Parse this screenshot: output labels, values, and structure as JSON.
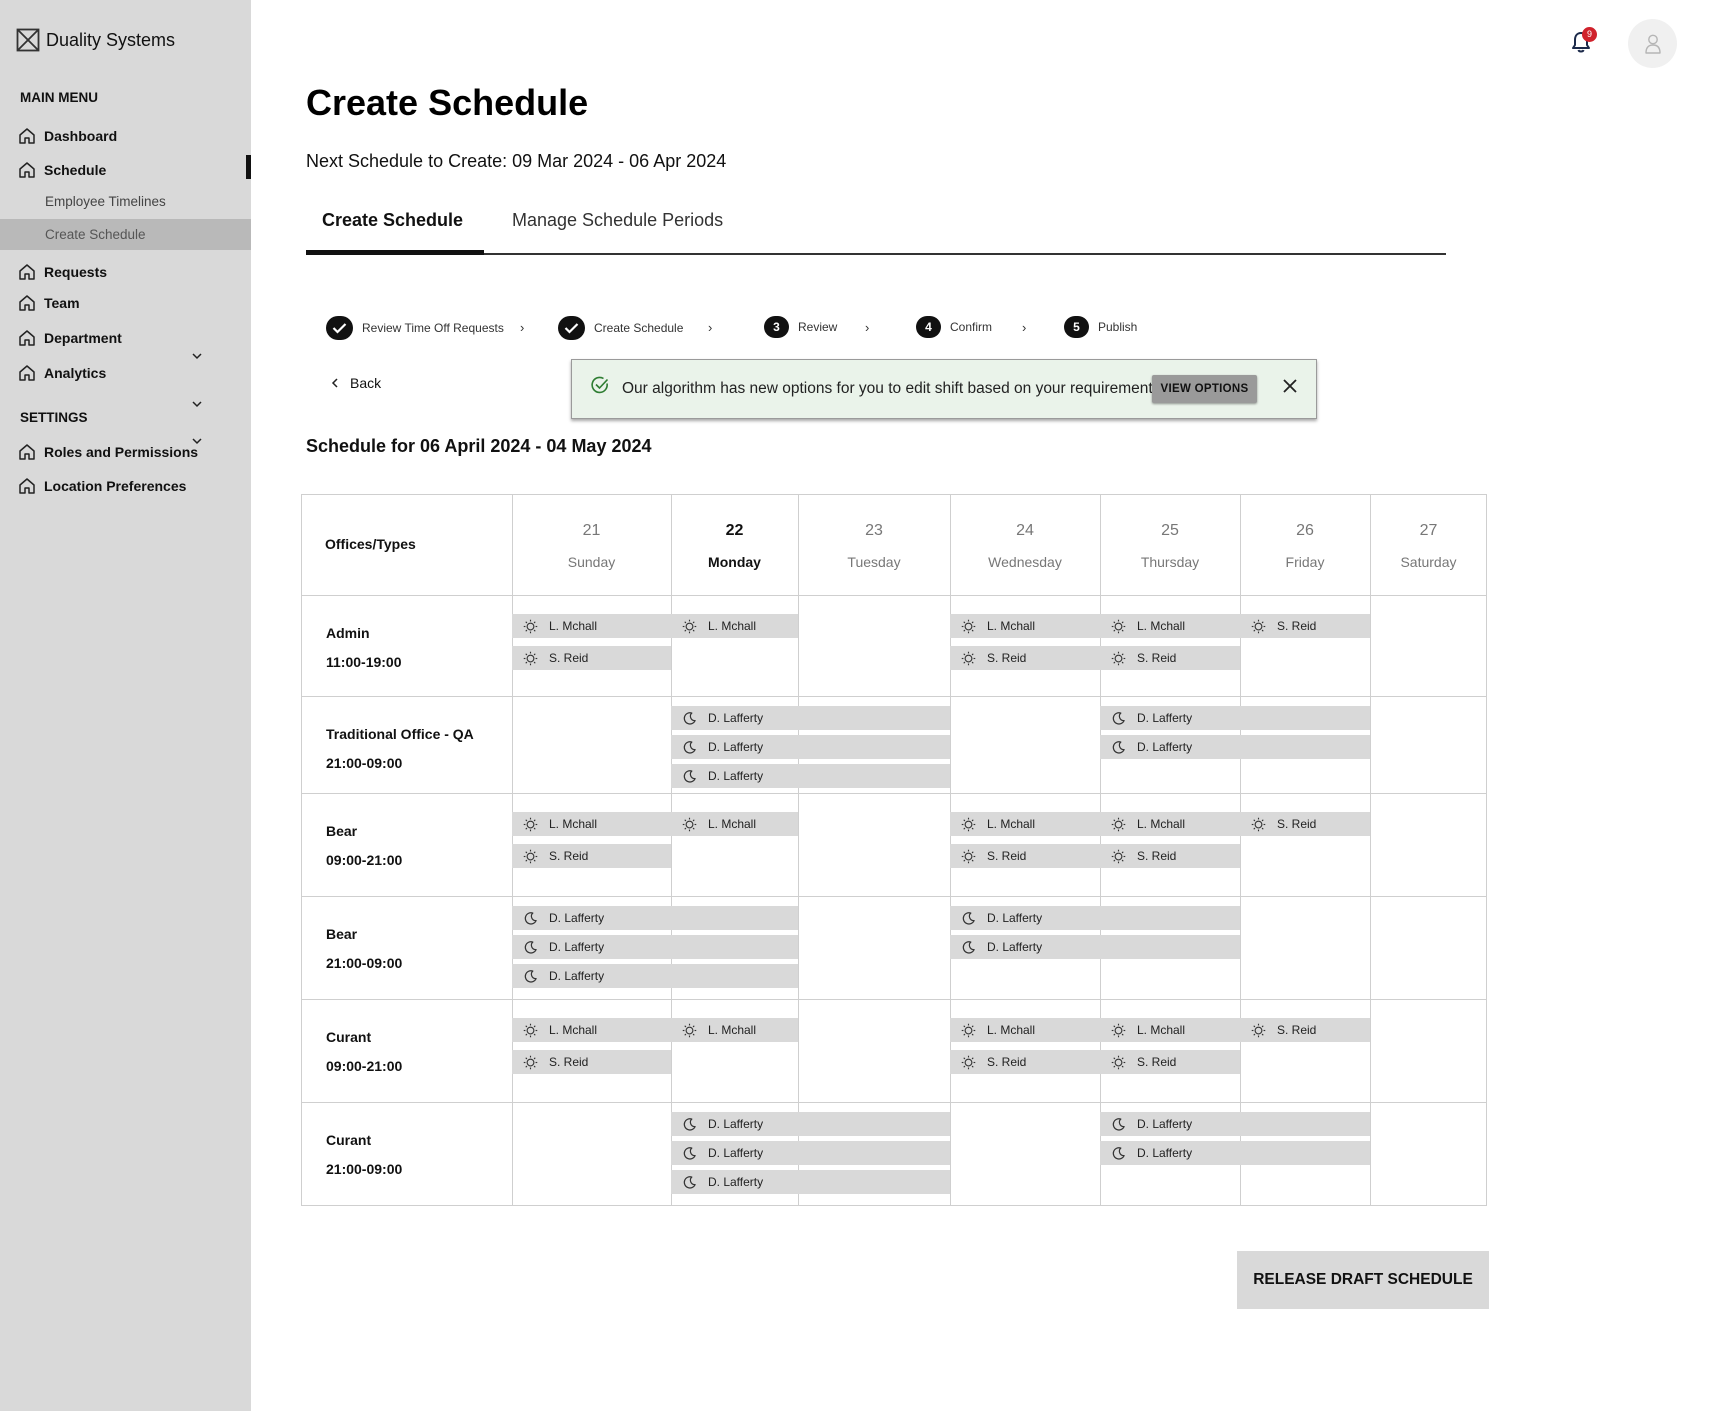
{
  "app": {
    "brand": "Duality Systems",
    "notification_count": "9"
  },
  "sidebar": {
    "main_menu_title": "MAIN MENU",
    "settings_title": "SETTINGS",
    "items": {
      "dashboard": "Dashboard",
      "schedule": "Schedule",
      "employee_timelines": "Employee Timelines",
      "create_schedule": "Create Schedule",
      "requests": "Requests",
      "team": "Team",
      "department": "Department",
      "analytics": "Analytics",
      "roles": "Roles and Permissions",
      "location": "Location Preferences"
    }
  },
  "header": {
    "title": "Create Schedule",
    "next_schedule": "Next Schedule to Create: 09 Mar 2024 - 06 Apr 2024",
    "tabs": [
      "Create Schedule",
      "Manage Schedule Periods"
    ]
  },
  "stepper": {
    "steps": [
      {
        "label": "Review Time Off Requests",
        "state": "done"
      },
      {
        "label": "Create Schedule",
        "state": "done"
      },
      {
        "label": "Review",
        "number": "3"
      },
      {
        "label": "Confirm",
        "number": "4"
      },
      {
        "label": "Publish",
        "number": "5"
      }
    ]
  },
  "back_label": "Back",
  "toast": {
    "message": "Our algorithm has new options for you to edit shift based on your requirement.",
    "button": "VIEW OPTIONS"
  },
  "schedule": {
    "heading": "Schedule for 06 April 2024 - 04 May 2024",
    "first_column_header": "Offices/Types",
    "days": [
      {
        "num": "21",
        "name": "Sunday"
      },
      {
        "num": "22",
        "name": "Monday",
        "today": true
      },
      {
        "num": "23",
        "name": "Tuesday"
      },
      {
        "num": "24",
        "name": "Wednesday"
      },
      {
        "num": "25",
        "name": "Thursday"
      },
      {
        "num": "26",
        "name": "Friday"
      },
      {
        "num": "27",
        "name": "Saturday"
      }
    ],
    "rows": [
      {
        "office": "Admin",
        "hours": "11:00-19:00"
      },
      {
        "office": "Traditional Office - QA",
        "hours": "21:00-09:00"
      },
      {
        "office": "Bear",
        "hours": "09:00-21:00"
      },
      {
        "office": "Bear",
        "hours": "21:00-09:00"
      },
      {
        "office": "Curant",
        "hours": "09:00-21:00"
      },
      {
        "office": "Curant",
        "hours": "21:00-09:00"
      }
    ],
    "shifts": [
      {
        "row": 0,
        "day": 0,
        "name": "L. Mchall",
        "type": "day"
      },
      {
        "row": 0,
        "day": 0,
        "name": "S. Reid",
        "type": "day"
      },
      {
        "row": 0,
        "day": 1,
        "name": "L. Mchall",
        "type": "day"
      },
      {
        "row": 0,
        "day": 3,
        "name": "L. Mchall",
        "type": "day"
      },
      {
        "row": 0,
        "day": 3,
        "name": "S. Reid",
        "type": "day"
      },
      {
        "row": 0,
        "day": 4,
        "name": "L. Mchall",
        "type": "day"
      },
      {
        "row": 0,
        "day": 4,
        "name": "S. Reid",
        "type": "day"
      },
      {
        "row": 0,
        "day": 5,
        "name": "S. Reid",
        "type": "day"
      },
      {
        "row": 1,
        "day": 1,
        "name": "D. Lafferty",
        "type": "night"
      },
      {
        "row": 1,
        "day": 1,
        "name": "D. Lafferty",
        "type": "night"
      },
      {
        "row": 1,
        "day": 1,
        "name": "D. Lafferty",
        "type": "night"
      },
      {
        "row": 1,
        "day": 4,
        "name": "D. Lafferty",
        "type": "night"
      },
      {
        "row": 1,
        "day": 4,
        "name": "D. Lafferty",
        "type": "night"
      },
      {
        "row": 2,
        "day": 0,
        "name": "L. Mchall",
        "type": "day"
      },
      {
        "row": 2,
        "day": 0,
        "name": "S. Reid",
        "type": "day"
      },
      {
        "row": 2,
        "day": 1,
        "name": "L. Mchall",
        "type": "day"
      },
      {
        "row": 2,
        "day": 3,
        "name": "L. Mchall",
        "type": "day"
      },
      {
        "row": 2,
        "day": 3,
        "name": "S. Reid",
        "type": "day"
      },
      {
        "row": 2,
        "day": 4,
        "name": "L. Mchall",
        "type": "day"
      },
      {
        "row": 2,
        "day": 4,
        "name": "S. Reid",
        "type": "day"
      },
      {
        "row": 2,
        "day": 5,
        "name": "S. Reid",
        "type": "day"
      },
      {
        "row": 3,
        "day": 0,
        "name": "D. Lafferty",
        "type": "night"
      },
      {
        "row": 3,
        "day": 0,
        "name": "D. Lafferty",
        "type": "night"
      },
      {
        "row": 3,
        "day": 0,
        "name": "D. Lafferty",
        "type": "night"
      },
      {
        "row": 3,
        "day": 3,
        "name": "D. Lafferty",
        "type": "night"
      },
      {
        "row": 3,
        "day": 3,
        "name": "D. Lafferty",
        "type": "night"
      },
      {
        "row": 4,
        "day": 0,
        "name": "L. Mchall",
        "type": "day"
      },
      {
        "row": 4,
        "day": 0,
        "name": "S. Reid",
        "type": "day"
      },
      {
        "row": 4,
        "day": 1,
        "name": "L. Mchall",
        "type": "day"
      },
      {
        "row": 4,
        "day": 3,
        "name": "L. Mchall",
        "type": "day"
      },
      {
        "row": 4,
        "day": 3,
        "name": "S. Reid",
        "type": "day"
      },
      {
        "row": 4,
        "day": 4,
        "name": "L. Mchall",
        "type": "day"
      },
      {
        "row": 4,
        "day": 4,
        "name": "S. Reid",
        "type": "day"
      },
      {
        "row": 4,
        "day": 5,
        "name": "S. Reid",
        "type": "day"
      },
      {
        "row": 5,
        "day": 1,
        "name": "D. Lafferty",
        "type": "night"
      },
      {
        "row": 5,
        "day": 1,
        "name": "D. Lafferty",
        "type": "night"
      },
      {
        "row": 5,
        "day": 1,
        "name": "D. Lafferty",
        "type": "night"
      },
      {
        "row": 5,
        "day": 4,
        "name": "D. Lafferty",
        "type": "night"
      },
      {
        "row": 5,
        "day": 4,
        "name": "D. Lafferty",
        "type": "night"
      }
    ]
  },
  "release_button": "RELEASE DRAFT SCHEDULE"
}
